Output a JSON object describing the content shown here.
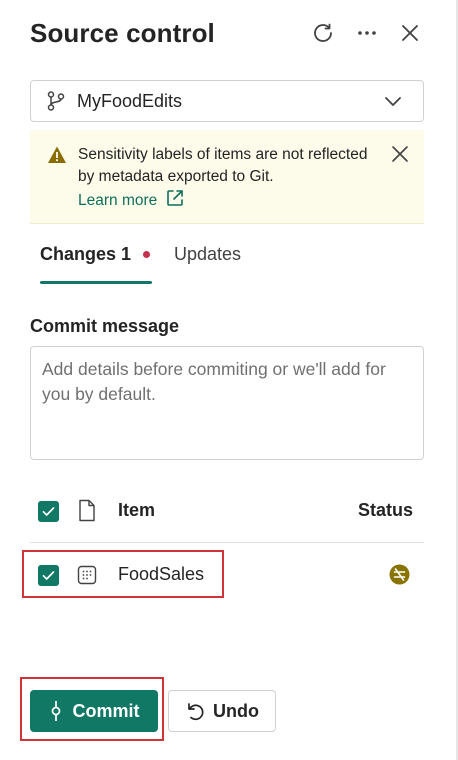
{
  "header": {
    "title": "Source control",
    "icons": [
      "refresh-icon",
      "more-icon",
      "close-icon"
    ]
  },
  "branch": {
    "name": "MyFoodEdits",
    "icon": "branch-icon"
  },
  "banner": {
    "message": "Sensitivity labels of items are not reflected by metadata exported to Git.",
    "link_label": "Learn more",
    "icons": [
      "warning-icon",
      "external-link-icon",
      "dismiss-icon"
    ]
  },
  "tabs": [
    {
      "label": "Changes 1",
      "active": true,
      "has_dot": true
    },
    {
      "label": "Updates",
      "active": false
    }
  ],
  "commit_message": {
    "label": "Commit message",
    "placeholder": "Add details before commiting or we'll add for you by default.",
    "value": ""
  },
  "table": {
    "columns": [
      "Item",
      "Status"
    ],
    "rows": [
      {
        "name": "FoodSales",
        "checked": true,
        "item_icon": "semantic-model-icon",
        "status_icon": "status-conflict-icon"
      }
    ],
    "select_all_checked": true
  },
  "footer": {
    "commit_label": "Commit",
    "undo_label": "Undo"
  },
  "colors": {
    "accent": "#117865",
    "link": "#0f6e5c",
    "banner_bg": "#fdfbe9",
    "warning": "#8a6d00",
    "status_icon": "#8a7400",
    "dot": "#c4314b",
    "highlight": "#d13438"
  }
}
